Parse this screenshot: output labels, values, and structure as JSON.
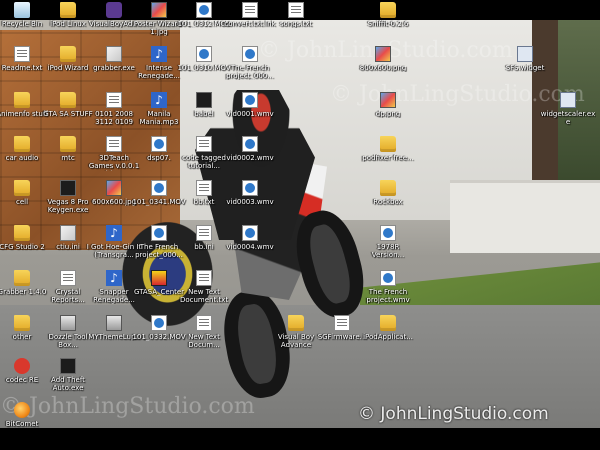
{
  "desktop": {
    "wallpaper_watermark": "© JohnLingStudio.com",
    "icons": [
      {
        "label": "Recycle Bin",
        "icon": "recycle-bin-icon",
        "type": "recycle"
      },
      {
        "label": "iPod Linux",
        "icon": "folder-icon",
        "type": "folder"
      },
      {
        "label": "VisualBoyAd...",
        "icon": "visualboy-icon",
        "type": "visualboy"
      },
      {
        "label": "Poster Wizard-1.jpg",
        "icon": "image-file-icon",
        "type": "image"
      },
      {
        "label": "101_0312.MOV",
        "icon": "movie-file-icon",
        "type": "movie"
      },
      {
        "label": "convert.txt.lnk",
        "icon": "text-file-icon",
        "type": "doc"
      },
      {
        "label": "songs.txt",
        "icon": "text-file-icon",
        "type": "doc"
      },
      {
        "label": "Sniffit-0.2.6",
        "icon": "folder-icon",
        "type": "folder"
      },
      {
        "label": "Readme.txt",
        "icon": "text-file-icon",
        "type": "doc"
      },
      {
        "label": "iPod Wizard",
        "icon": "folder-icon",
        "type": "folder"
      },
      {
        "label": "grabber.exe",
        "icon": "installer-icon",
        "type": "installer"
      },
      {
        "label": "Intense Renegade...",
        "icon": "music-file-icon",
        "type": "music"
      },
      {
        "label": "101_0310.MOV",
        "icon": "movie-file-icon",
        "type": "movie"
      },
      {
        "label": "The French project_000...",
        "icon": "movie-file-icon",
        "type": "movie"
      },
      {
        "label": "800x600.png",
        "icon": "image-file-icon",
        "type": "image"
      },
      {
        "label": "SFS.widget",
        "icon": "gadget-icon",
        "type": "gadget"
      },
      {
        "label": "Animenfo stuff",
        "icon": "folder-icon",
        "type": "folder"
      },
      {
        "label": "GTA SA STUFF",
        "icon": "folder-icon",
        "type": "folder"
      },
      {
        "label": "0101 2008 3112 0109",
        "icon": "text-file-icon",
        "type": "doc"
      },
      {
        "label": "Manila Mania.mp3",
        "icon": "music-file-icon",
        "type": "music"
      },
      {
        "label": "babel",
        "icon": "app-icon",
        "type": "app"
      },
      {
        "label": "vid0001.wmv",
        "icon": "movie-file-icon",
        "type": "movie"
      },
      {
        "label": "dp.png",
        "icon": "image-file-icon",
        "type": "image"
      },
      {
        "label": "widgetscaler.exe",
        "icon": "gadget-icon",
        "type": "gadget"
      },
      {
        "label": "car audio",
        "icon": "folder-icon",
        "type": "folder"
      },
      {
        "label": "mtc",
        "icon": "folder-icon",
        "type": "folder"
      },
      {
        "label": "3DTeach Games v.0.0.1 (rip...",
        "icon": "text-file-icon",
        "type": "doc"
      },
      {
        "label": "dsp07.",
        "icon": "movie-file-icon",
        "type": "movie"
      },
      {
        "label": "code tagged tutorial...",
        "icon": "text-file-icon",
        "type": "doc"
      },
      {
        "label": "vid0002.wmv",
        "icon": "movie-file-icon",
        "type": "movie"
      },
      {
        "label": "podfixer free...",
        "icon": "folder-icon",
        "type": "folder"
      },
      {
        "label": "cell",
        "icon": "folder-icon",
        "type": "folder"
      },
      {
        "label": "Vegas 8 Pro Keygen.exe",
        "icon": "app-icon",
        "type": "app"
      },
      {
        "label": "600x600.jpg",
        "icon": "image-file-icon",
        "type": "image"
      },
      {
        "label": "101_0341.MOV",
        "icon": "movie-file-icon",
        "type": "movie"
      },
      {
        "label": "bb.txt",
        "icon": "text-file-icon",
        "type": "doc"
      },
      {
        "label": "vid0003.wmv",
        "icon": "movie-file-icon",
        "type": "movie"
      },
      {
        "label": "Rockbox",
        "icon": "folder-icon",
        "type": "folder"
      },
      {
        "label": "CFG Studio 2",
        "icon": "folder-icon",
        "type": "folder"
      },
      {
        "label": "ctiu.ini",
        "icon": "installer-icon",
        "type": "installer"
      },
      {
        "label": "I Got Hoe-Gin It (Transgra...",
        "icon": "music-file-icon",
        "type": "music"
      },
      {
        "label": "The French project_000...",
        "icon": "movie-file-icon",
        "type": "movie"
      },
      {
        "label": "bb.ini",
        "icon": "text-file-icon",
        "type": "doc"
      },
      {
        "label": "vid0004.wmv",
        "icon": "movie-file-icon",
        "type": "movie"
      },
      {
        "label": "1978R Version...",
        "icon": "movie-file-icon",
        "type": "movie"
      },
      {
        "label": "Grabber 1.4.0",
        "icon": "folder-icon",
        "type": "folder"
      },
      {
        "label": "Crystal Reports...",
        "icon": "text-file-icon",
        "type": "doc"
      },
      {
        "label": "Snapper Renegade...",
        "icon": "music-file-icon",
        "type": "music"
      },
      {
        "label": "GTASA_Center",
        "icon": "gta-icon",
        "type": "gta"
      },
      {
        "label": "New Text Document.txt",
        "icon": "text-file-icon",
        "type": "doc"
      },
      {
        "label": "The French project.wmv",
        "icon": "movie-file-icon",
        "type": "movie"
      },
      {
        "label": "other",
        "icon": "folder-icon",
        "type": "folder"
      },
      {
        "label": "Dozzle Tool Box...",
        "icon": "game-icon",
        "type": "game"
      },
      {
        "label": "MYThemeLupo",
        "icon": "media-icon",
        "type": "game"
      },
      {
        "label": "101_0332.MOV",
        "icon": "movie-file-icon",
        "type": "movie"
      },
      {
        "label": "New Text Docum...",
        "icon": "text-file-icon",
        "type": "doc"
      },
      {
        "label": "Visual Boy Advance",
        "icon": "folder-icon",
        "type": "folder"
      },
      {
        "label": "SGFirmware...",
        "icon": "text-file-icon",
        "type": "doc"
      },
      {
        "label": "iPodApplicat...",
        "icon": "folder-icon",
        "type": "folder"
      },
      {
        "label": "codec RE",
        "icon": "media-player-icon",
        "type": "media"
      },
      {
        "label": "Add Theft Auto.exe",
        "icon": "app-icon",
        "type": "app"
      },
      {
        "label": "BitComet",
        "icon": "bitcomet-icon",
        "type": "bitcomet"
      }
    ]
  }
}
